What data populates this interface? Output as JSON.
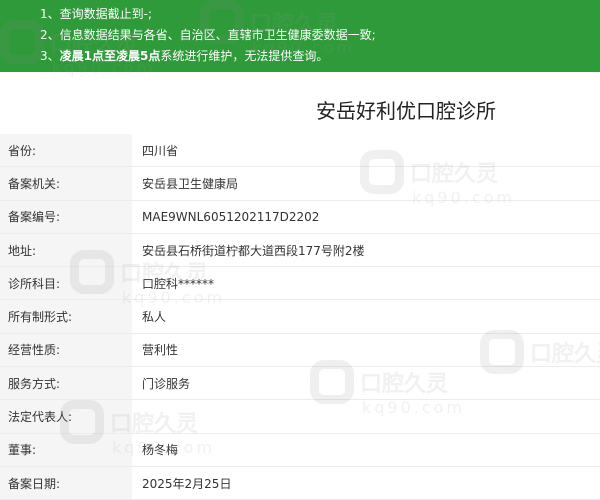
{
  "notice": {
    "items": [
      {
        "num": "1、",
        "text": "查询数据截止到-;"
      },
      {
        "num": "2、",
        "text": "信息数据结果与各省、自治区、直辖市卫生健康委数据一致;"
      },
      {
        "num": "3、",
        "bold": "凌晨1点至凌晨5点",
        "text": "系统进行维护，无法提供查询。"
      }
    ]
  },
  "title": "安岳好利优口腔诊所",
  "rows": [
    {
      "label": "省份:",
      "value": "四川省"
    },
    {
      "label": "备案机关:",
      "value": "安岳县卫生健康局"
    },
    {
      "label": "备案编号:",
      "value": "MAE9WNL6051202117D2202"
    },
    {
      "label": "地址:",
      "value": "安岳县石桥街道柠都大道西段177号附2楼"
    },
    {
      "label": "诊所科目:",
      "value": "口腔科******"
    },
    {
      "label": "所有制形式:",
      "value": "私人"
    },
    {
      "label": "经营性质:",
      "value": "营利性"
    },
    {
      "label": "服务方式:",
      "value": "门诊服务"
    },
    {
      "label": "法定代表人:",
      "value": ""
    },
    {
      "label": "董事:",
      "value": "杨冬梅"
    },
    {
      "label": "备案日期:",
      "value": "2025年2月25日"
    }
  ],
  "watermark": {
    "cn": "口腔久灵",
    "url": "kq90.com"
  },
  "colors": {
    "notice_bg": "#2e9a3a",
    "label_bg": "#f5f5f5"
  }
}
